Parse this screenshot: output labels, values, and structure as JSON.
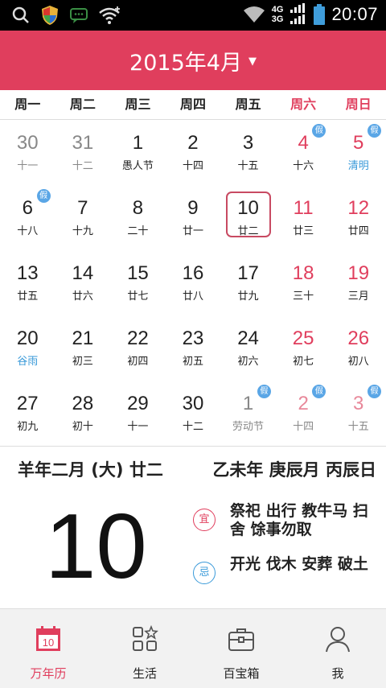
{
  "status_bar": {
    "time": "20:07",
    "net_top": "4G",
    "net_bottom": "3G",
    "icons": [
      "search-icon",
      "shield-icon",
      "message-icon",
      "wifi-icon",
      "wifi-signal-icon",
      "signal-icon",
      "battery-icon"
    ]
  },
  "header": {
    "title": "2015年4月",
    "dropdown_icon": "chevron-down-icon",
    "color": "#e03e5d"
  },
  "weekdays": [
    "周一",
    "周二",
    "周三",
    "周四",
    "周五",
    "周六",
    "周日"
  ],
  "badge_label": "假",
  "calendar": {
    "weeks": [
      [
        {
          "day": "30",
          "lunar": "十一",
          "style": "gray"
        },
        {
          "day": "31",
          "lunar": "十二",
          "style": "gray"
        },
        {
          "day": "1",
          "lunar": "愚人节",
          "style": "black"
        },
        {
          "day": "2",
          "lunar": "十四",
          "style": "black"
        },
        {
          "day": "3",
          "lunar": "十五",
          "style": "black"
        },
        {
          "day": "4",
          "lunar": "十六",
          "style": "weekend",
          "badge": true
        },
        {
          "day": "5",
          "lunar": "清明",
          "style": "weekend",
          "badge": true,
          "term": true
        }
      ],
      [
        {
          "day": "6",
          "lunar": "十八",
          "style": "black",
          "badge": true
        },
        {
          "day": "7",
          "lunar": "十九",
          "style": "black"
        },
        {
          "day": "8",
          "lunar": "二十",
          "style": "black"
        },
        {
          "day": "9",
          "lunar": "廿一",
          "style": "black"
        },
        {
          "day": "10",
          "lunar": "廿二",
          "style": "black",
          "today": true
        },
        {
          "day": "11",
          "lunar": "廿三",
          "style": "weekend"
        },
        {
          "day": "12",
          "lunar": "廿四",
          "style": "weekend"
        }
      ],
      [
        {
          "day": "13",
          "lunar": "廿五",
          "style": "black"
        },
        {
          "day": "14",
          "lunar": "廿六",
          "style": "black"
        },
        {
          "day": "15",
          "lunar": "廿七",
          "style": "black"
        },
        {
          "day": "16",
          "lunar": "廿八",
          "style": "black"
        },
        {
          "day": "17",
          "lunar": "廿九",
          "style": "black"
        },
        {
          "day": "18",
          "lunar": "三十",
          "style": "weekend"
        },
        {
          "day": "19",
          "lunar": "三月",
          "style": "weekend"
        }
      ],
      [
        {
          "day": "20",
          "lunar": "谷雨",
          "style": "black",
          "term": true
        },
        {
          "day": "21",
          "lunar": "初三",
          "style": "black"
        },
        {
          "day": "22",
          "lunar": "初四",
          "style": "black"
        },
        {
          "day": "23",
          "lunar": "初五",
          "style": "black"
        },
        {
          "day": "24",
          "lunar": "初六",
          "style": "black"
        },
        {
          "day": "25",
          "lunar": "初七",
          "style": "weekend"
        },
        {
          "day": "26",
          "lunar": "初八",
          "style": "weekend"
        }
      ],
      [
        {
          "day": "27",
          "lunar": "初九",
          "style": "black"
        },
        {
          "day": "28",
          "lunar": "初十",
          "style": "black"
        },
        {
          "day": "29",
          "lunar": "十一",
          "style": "black"
        },
        {
          "day": "30",
          "lunar": "十二",
          "style": "black"
        },
        {
          "day": "1",
          "lunar": "劳动节",
          "style": "gray",
          "badge": true
        },
        {
          "day": "2",
          "lunar": "十四",
          "style": "gray-weekend",
          "badge": true
        },
        {
          "day": "3",
          "lunar": "十五",
          "style": "gray-weekend",
          "badge": true
        }
      ]
    ]
  },
  "detail": {
    "lunar_date": "羊年二月 (大) 廿二",
    "ganzhi": "乙未年 庚辰月 丙辰日",
    "big_day": "10",
    "yi_label": "宜",
    "yi_text": "祭祀 出行 教牛马 扫舍 馀事勿取",
    "ji_label": "忌",
    "ji_text": "开光 伐木 安葬 破土"
  },
  "bottom_nav": [
    {
      "label": "万年历",
      "icon": "calendar-icon",
      "active": true
    },
    {
      "label": "生活",
      "icon": "apps-icon",
      "active": false
    },
    {
      "label": "百宝箱",
      "icon": "toolbox-icon",
      "active": false
    },
    {
      "label": "我",
      "icon": "person-icon",
      "active": false
    }
  ],
  "nav_calendar_icon_number": "10"
}
